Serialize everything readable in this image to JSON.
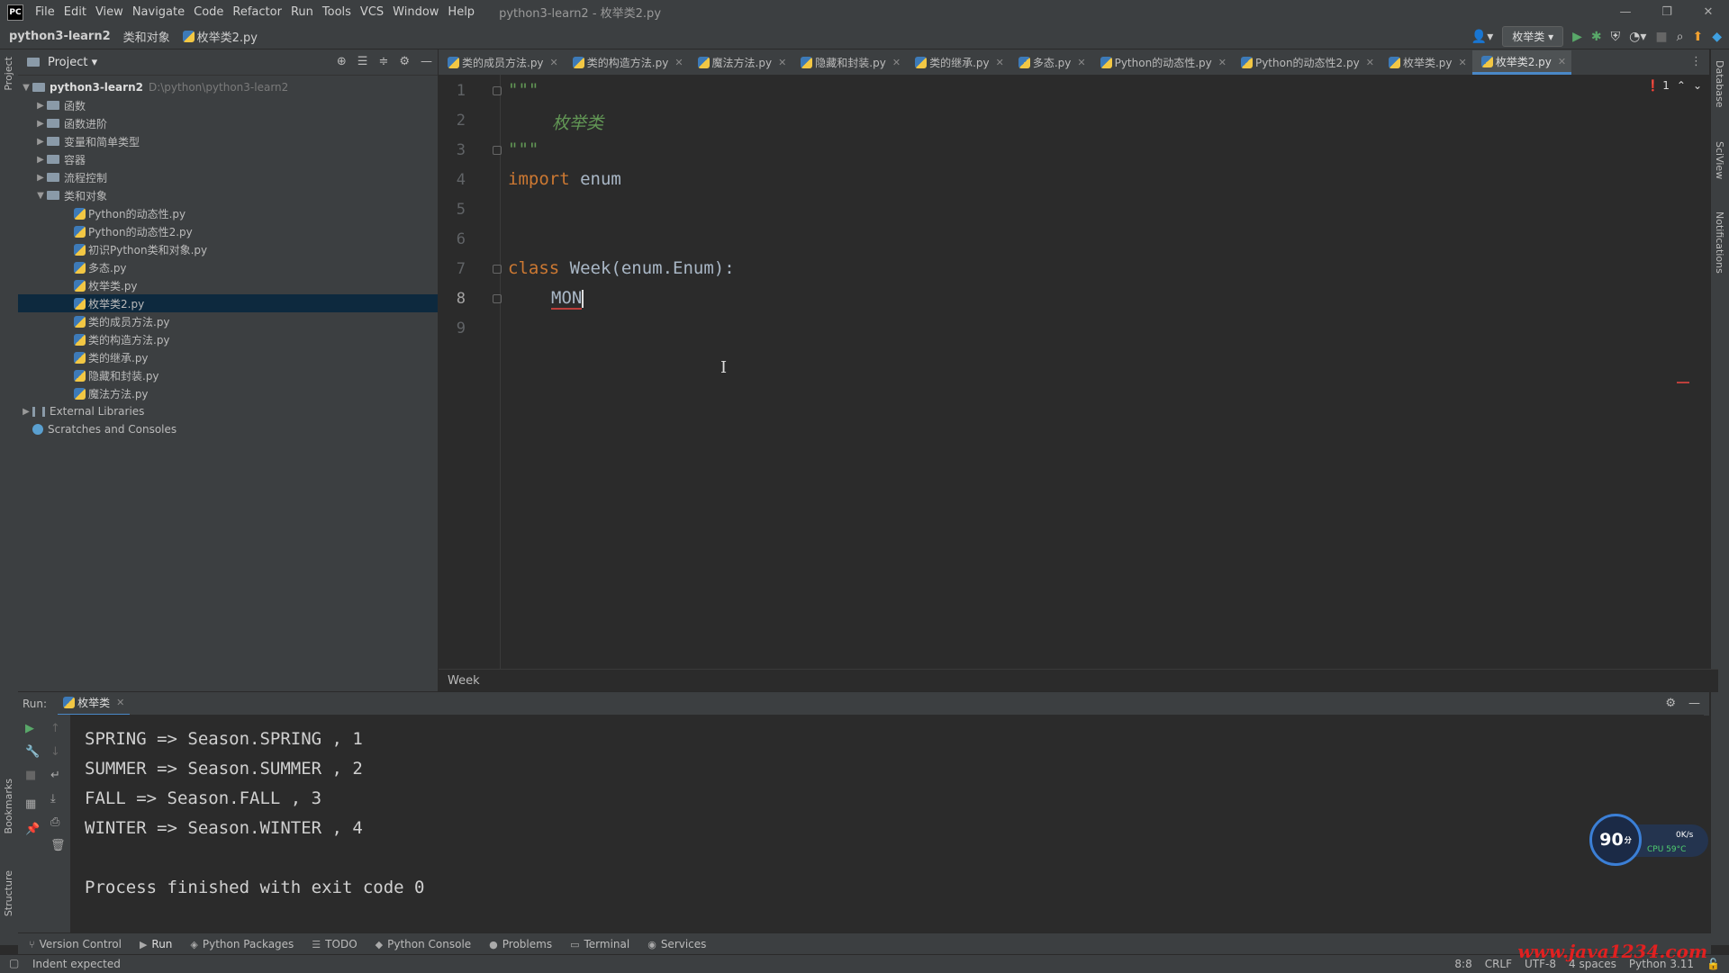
{
  "app": {
    "logo": "PC",
    "window_title": "python3-learn2 - 枚举类2.py",
    "menu": [
      "File",
      "Edit",
      "View",
      "Navigate",
      "Code",
      "Refactor",
      "Run",
      "Tools",
      "VCS",
      "Window",
      "Help"
    ],
    "window_controls": {
      "minimize": "—",
      "restore": "❐",
      "close": "✕"
    }
  },
  "navbar": {
    "breadcrumbs": [
      "python3-learn2",
      "类和对象",
      "枚举类2.py"
    ],
    "run_config": "枚举类 ▾"
  },
  "side_strips": {
    "left_top": "Project",
    "left_bottom": [
      "Bookmarks",
      "Structure"
    ],
    "right": [
      "Database",
      "SciView",
      "Notifications"
    ]
  },
  "project": {
    "title": "Project ▾",
    "root": {
      "name": "python3-learn2",
      "path": "D:\\python\\python3-learn2"
    },
    "folders": [
      "函数",
      "函数进阶",
      "变量和简单类型",
      "容器",
      "流程控制"
    ],
    "open_folder": "类和对象",
    "files": [
      "Python的动态性.py",
      "Python的动态性2.py",
      "初识Python类和对象.py",
      "多态.py",
      "枚举类.py",
      "枚举类2.py",
      "类的成员方法.py",
      "类的构造方法.py",
      "类的继承.py",
      "隐藏和封装.py",
      "魔法方法.py"
    ],
    "selected_file": "枚举类2.py",
    "external_libraries": "External Libraries",
    "scratches": "Scratches and Consoles"
  },
  "tabs": [
    "类的成员方法.py",
    "类的构造方法.py",
    "魔法方法.py",
    "隐藏和封装.py",
    "类的继承.py",
    "多态.py",
    "Python的动态性.py",
    "Python的动态性2.py",
    "枚举类.py",
    "枚举类2.py"
  ],
  "active_tab": "枚举类2.py",
  "error_count": "1",
  "editor": {
    "line_numbers": [
      "1",
      "2",
      "3",
      "4",
      "5",
      "6",
      "7",
      "8",
      "9"
    ],
    "current_line": "8",
    "code": {
      "l1": "\"\"\"",
      "l2": "枚举类",
      "l3": "\"\"\"",
      "l4_kw": "import",
      "l4_rest": " enum",
      "l7_kw": "class",
      "l7_rest": " Week(enum.Enum):",
      "l8": "MON"
    },
    "breadcrumb": "Week"
  },
  "run": {
    "label": "Run:",
    "tab": "枚举类",
    "output": [
      "SPRING => Season.SPRING , 1",
      "SUMMER => Season.SUMMER , 2",
      "FALL => Season.FALL , 3",
      "WINTER => Season.WINTER , 4",
      "",
      "Process finished with exit code 0"
    ]
  },
  "widget": {
    "score": "90",
    "unit": "分",
    "net": "0K/s",
    "cpu": "CPU 59°C"
  },
  "toolwindows": [
    "Version Control",
    "Run",
    "Python Packages",
    "TODO",
    "Python Console",
    "Problems",
    "Terminal",
    "Services"
  ],
  "status": {
    "message": "Indent expected",
    "position": "8:8",
    "line_sep": "CRLF",
    "encoding": "UTF-8",
    "indent": "4 spaces",
    "interpreter": "Python 3.11"
  },
  "watermark": "www.java1234.com",
  "colors": {
    "keyword": "#cc7832",
    "docstring": "#629755",
    "accent": "#4a88c7",
    "error": "#bc3f3c"
  }
}
